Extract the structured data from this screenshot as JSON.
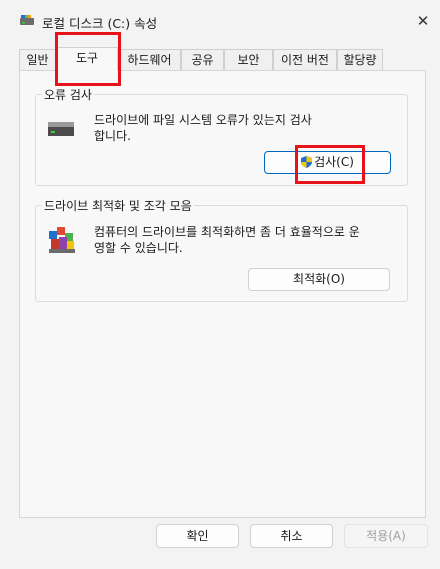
{
  "window": {
    "title": "로컬 디스크 (C:) 속성",
    "icons": {
      "title": "drive-icon",
      "close": "close-icon"
    }
  },
  "tabs": [
    {
      "label": "일반"
    },
    {
      "label": "도구"
    },
    {
      "label": "하드웨어"
    },
    {
      "label": "공유"
    },
    {
      "label": "보안"
    },
    {
      "label": "이전 버전"
    },
    {
      "label": "할당량"
    }
  ],
  "error_check": {
    "group_label": "오류 검사",
    "description_line1": "드라이브에 파일 시스템 오류가 있는지 검사",
    "description_line2": "합니다.",
    "button_label": "검사(C)",
    "icons": {
      "drive": "hard-drive-icon",
      "button": "uac-shield-icon"
    }
  },
  "optimize": {
    "group_label": "드라이브 최적화 및 조각 모음",
    "description_line1": "컴퓨터의 드라이브를 최적화하면 좀 더 효율적으로 운",
    "description_line2": "영할 수 있습니다.",
    "button_label": "최적화(O)",
    "icons": {
      "group": "defrag-icon"
    }
  },
  "footer": {
    "ok_label": "확인",
    "cancel_label": "취소",
    "apply_label": "적용(A)"
  },
  "colors": {
    "accent": "#0067c0",
    "highlight": "#e8131a",
    "background": "#f3f3f3"
  }
}
